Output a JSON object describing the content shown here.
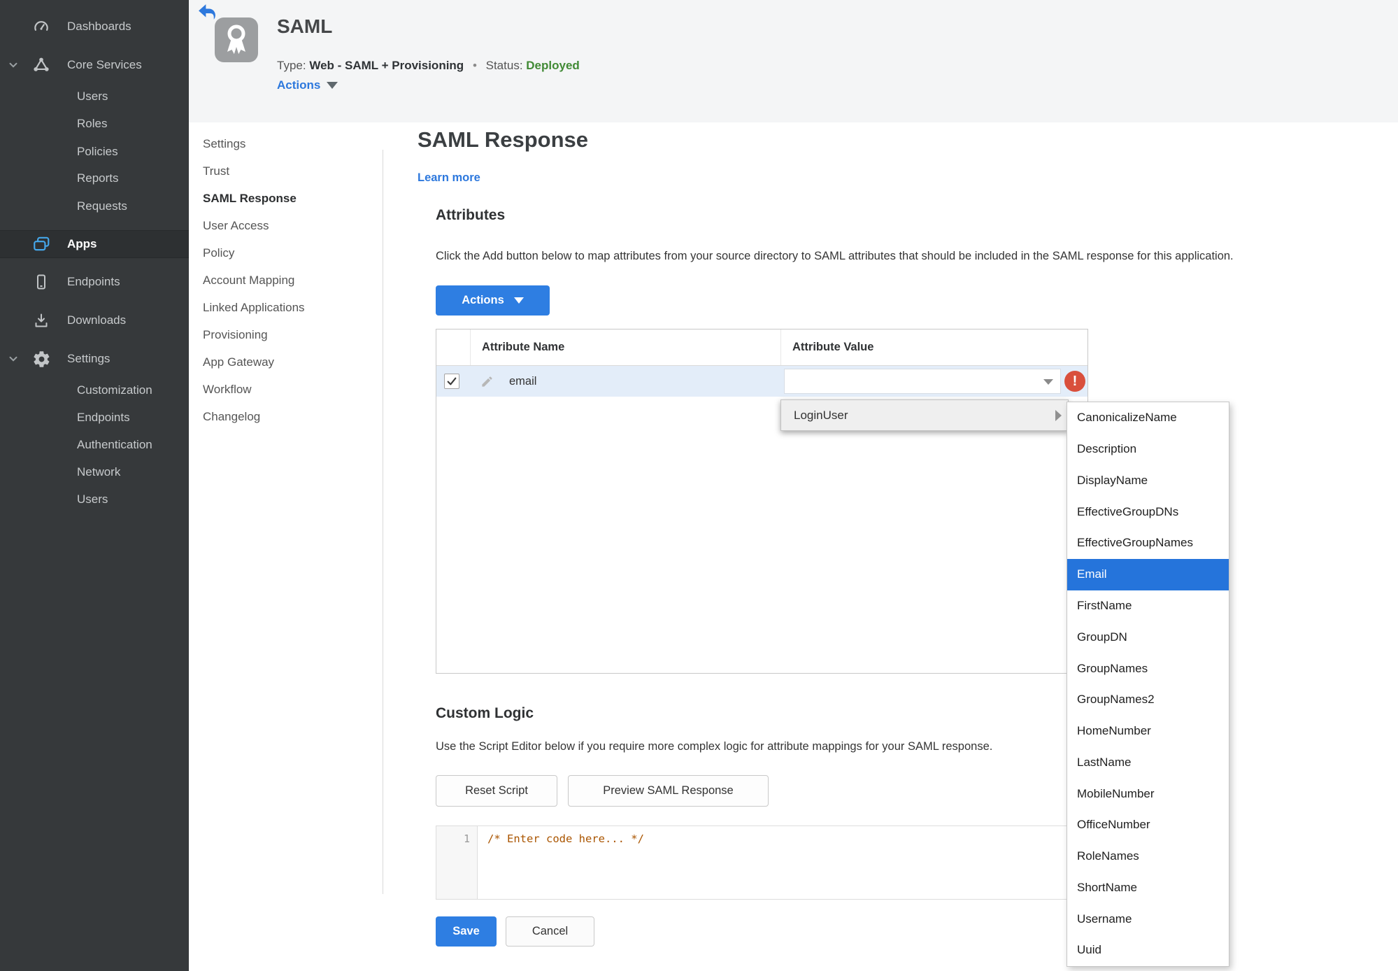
{
  "sidebar": {
    "items": [
      {
        "label": "Dashboards"
      },
      {
        "label": "Core Services"
      },
      {
        "label": "Users"
      },
      {
        "label": "Roles"
      },
      {
        "label": "Policies"
      },
      {
        "label": "Reports"
      },
      {
        "label": "Requests"
      },
      {
        "label": "Apps"
      },
      {
        "label": "Endpoints"
      },
      {
        "label": "Downloads"
      },
      {
        "label": "Settings"
      },
      {
        "label": "Customization"
      },
      {
        "label": "Endpoints"
      },
      {
        "label": "Authentication"
      },
      {
        "label": "Network"
      },
      {
        "label": "Users"
      }
    ]
  },
  "header": {
    "title": "SAML",
    "type_label": "Type:",
    "type_value": "Web - SAML + Provisioning",
    "separator": "•",
    "status_label": "Status:",
    "status_value": "Deployed",
    "actions_label": "Actions"
  },
  "subnav": {
    "active": "SAML Response",
    "items": [
      {
        "label": "Settings"
      },
      {
        "label": "Trust"
      },
      {
        "label": "SAML Response"
      },
      {
        "label": "User Access"
      },
      {
        "label": "Policy"
      },
      {
        "label": "Account Mapping"
      },
      {
        "label": "Linked Applications"
      },
      {
        "label": "Provisioning"
      },
      {
        "label": "App Gateway"
      },
      {
        "label": "Workflow"
      },
      {
        "label": "Changelog"
      }
    ]
  },
  "main": {
    "title": "SAML Response",
    "learn_more_label": "Learn more",
    "attributes": {
      "heading": "Attributes",
      "description": "Click the Add button below to map attributes from your source directory to SAML attributes that should be included in the SAML response for this application.",
      "actions_button_label": "Actions",
      "table": {
        "columns": [
          "Attribute Name",
          "Attribute Value"
        ],
        "rows": [
          {
            "checked": true,
            "name": "email",
            "value": "",
            "error": "!"
          }
        ]
      }
    },
    "value_menu": {
      "item_label": "LoginUser",
      "submenu": {
        "selected": "Email",
        "items": [
          "CanonicalizeName",
          "Description",
          "DisplayName",
          "EffectiveGroupDNs",
          "EffectiveGroupNames",
          "Email",
          "FirstName",
          "GroupDN",
          "GroupNames",
          "GroupNames2",
          "HomeNumber",
          "LastName",
          "MobileNumber",
          "OfficeNumber",
          "RoleNames",
          "ShortName",
          "Username",
          "Uuid"
        ]
      }
    },
    "custom_logic": {
      "heading": "Custom Logic",
      "description": "Use the Script Editor below if you require more complex logic for attribute mappings for your SAML response.",
      "reset_button_label": "Reset Script",
      "preview_button_label": "Preview SAML Response",
      "editor": {
        "line_number": "1",
        "code": "/* Enter code here... */"
      }
    },
    "footer": {
      "save_label": "Save",
      "cancel_label": "Cancel"
    }
  },
  "icons": {
    "back": "arrow-left",
    "app_badge": "award-ribbon",
    "dashboards": "gauge",
    "core_services": "cluster",
    "apps": "stacked-windows",
    "endpoints": "mobile-device",
    "downloads": "download-tray",
    "settings": "gear",
    "expand": "chevron-down",
    "edit": "pencil",
    "dropdown": "caret-down",
    "submenu": "caret-right",
    "error": "exclamation-circle",
    "checked": "checkmark"
  },
  "colors": {
    "accent_blue": "#2e7ee2",
    "selection_blue": "#2574db",
    "status_green": "#418a35",
    "error_red": "#d94f3c",
    "sidebar_bg": "#36393b",
    "app_icon_blue": "#45a7ea"
  }
}
